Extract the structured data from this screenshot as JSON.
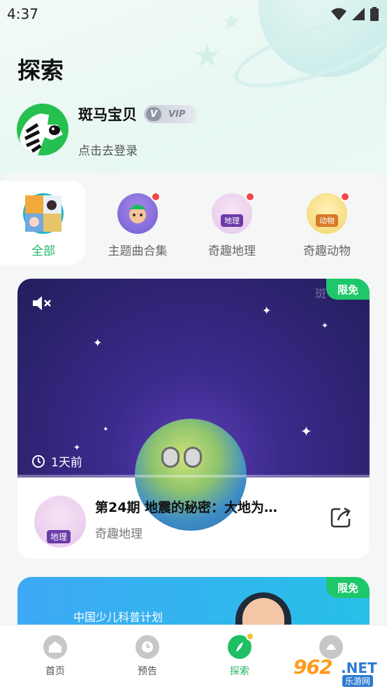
{
  "status_bar": {
    "time": "4:37"
  },
  "page": {
    "title": "探索"
  },
  "profile": {
    "name": "斑马宝贝",
    "vip_label": "VIP",
    "vip_icon_letter": "V",
    "login_prompt": "点击去登录"
  },
  "categories": [
    {
      "label": "全部",
      "active": true,
      "new": false
    },
    {
      "label": "主题曲合集",
      "active": false,
      "new": true
    },
    {
      "label": "奇趣地理",
      "active": false,
      "new": true,
      "icon_text": "地理"
    },
    {
      "label": "奇趣动物",
      "active": false,
      "new": true,
      "icon_text": "动物"
    }
  ],
  "feed": [
    {
      "badge": "限免",
      "watermark": "斑",
      "time_ago": "1天前",
      "title": "第24期 地震的秘密：大地为…",
      "series": "奇趣地理",
      "thumb_text": "地理"
    },
    {
      "badge": "限免",
      "caption": "中国少儿科普计划"
    }
  ],
  "tab_bar": {
    "tabs": [
      {
        "label": "首页",
        "active": false
      },
      {
        "label": "预告",
        "active": false
      },
      {
        "label": "探索",
        "active": true
      },
      {
        "label": "",
        "active": false
      }
    ]
  },
  "watermark_badge": {
    "number": "962",
    "suffix": ".NET",
    "cn": "乐游网"
  },
  "colors": {
    "accent_green": "#1fb863",
    "new_dot": "#f0484a",
    "free_badge": "#1ec86a"
  }
}
